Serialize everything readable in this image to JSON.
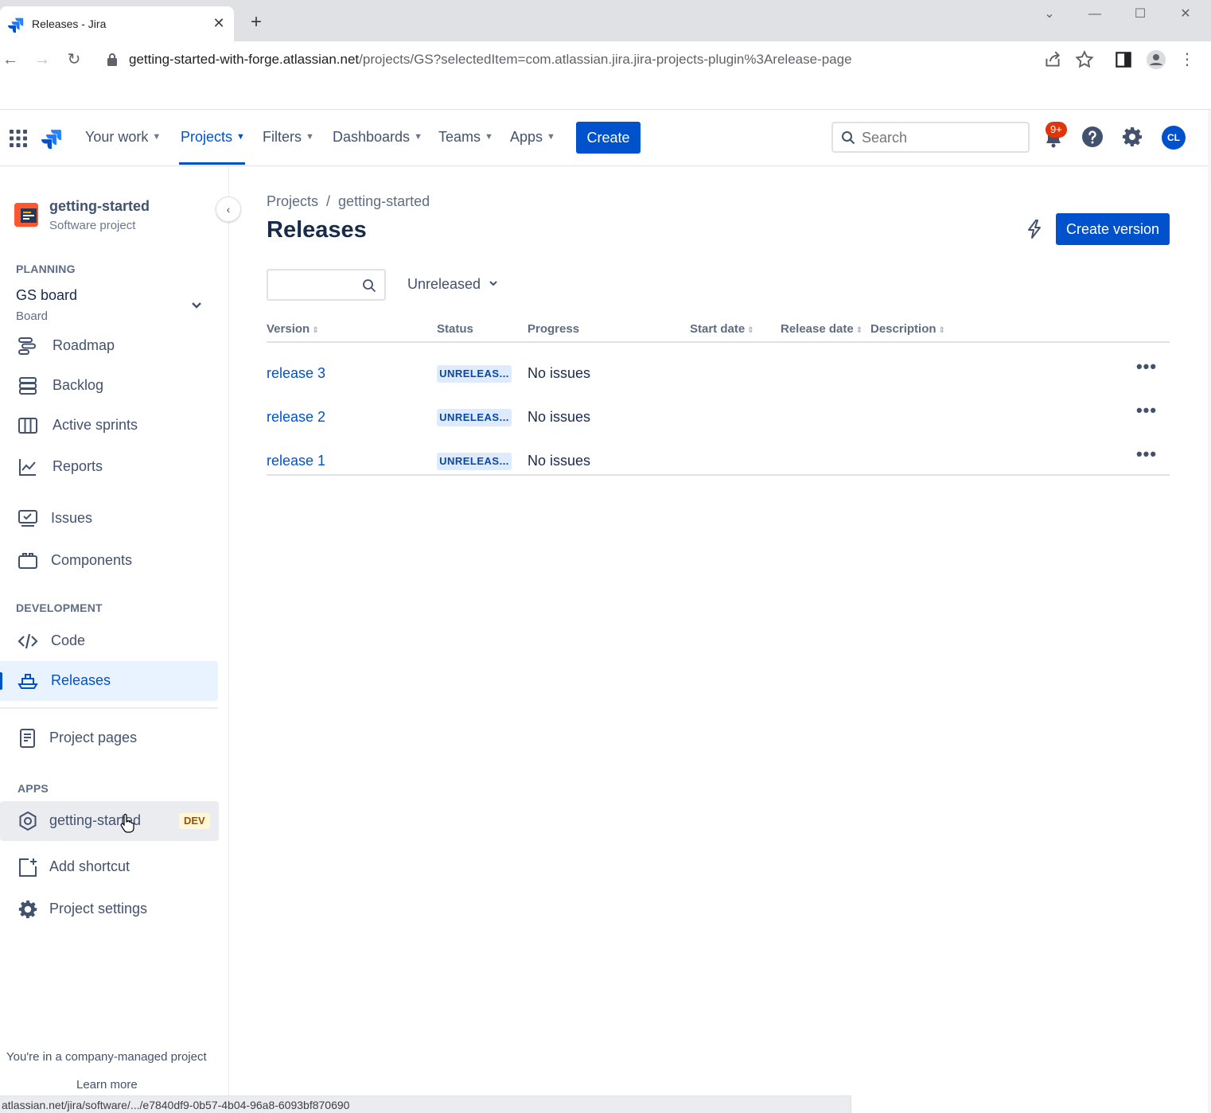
{
  "browser": {
    "tab_title": "Releases - Jira",
    "url_host": "getting-started-with-forge.atlassian.net",
    "url_path": "/projects/GS?selectedItem=com.atlassian.jira.jira-projects-plugin%3Arelease-page",
    "status_url": "atlassian.net/jira/software/.../e7840df9-0b57-4b04-96a8-6093bf870690"
  },
  "topnav": {
    "items": [
      "Your work",
      "Projects",
      "Filters",
      "Dashboards",
      "Teams",
      "Apps"
    ],
    "active": "Projects",
    "create_label": "Create",
    "search_placeholder": "Search",
    "notification_count": "9+",
    "avatar_initials": "CL",
    "accent": "#0052cc"
  },
  "sidebar": {
    "project_name": "getting-started",
    "project_type": "Software project",
    "planning_label": "PLANNING",
    "board_name": "GS board",
    "board_sub": "Board",
    "planning_items": [
      {
        "label": "Roadmap",
        "icon": "roadmap-icon"
      },
      {
        "label": "Backlog",
        "icon": "backlog-icon"
      },
      {
        "label": "Active sprints",
        "icon": "active-sprints-icon"
      },
      {
        "label": "Reports",
        "icon": "reports-icon"
      }
    ],
    "issues_label": "Issues",
    "components_label": "Components",
    "development_label": "DEVELOPMENT",
    "code_label": "Code",
    "releases_label": "Releases",
    "project_pages_label": "Project pages",
    "apps_label": "APPS",
    "app_item_label": "getting-started",
    "app_badge": "DEV",
    "add_shortcut_label": "Add shortcut",
    "project_settings_label": "Project settings",
    "footer_text": "You're in a company-managed project",
    "footer_link": "Learn more"
  },
  "main": {
    "breadcrumb": [
      "Projects",
      "getting-started"
    ],
    "title": "Releases",
    "create_version_label": "Create version",
    "status_filter": "Unreleased",
    "columns": [
      "Version",
      "Status",
      "Progress",
      "Start date",
      "Release date",
      "Description"
    ],
    "rows": [
      {
        "version": "release 3",
        "status": "UNRELEAS...",
        "progress": "No issues"
      },
      {
        "version": "release 2",
        "status": "UNRELEAS...",
        "progress": "No issues"
      },
      {
        "version": "release 1",
        "status": "UNRELEAS...",
        "progress": "No issues"
      }
    ]
  }
}
